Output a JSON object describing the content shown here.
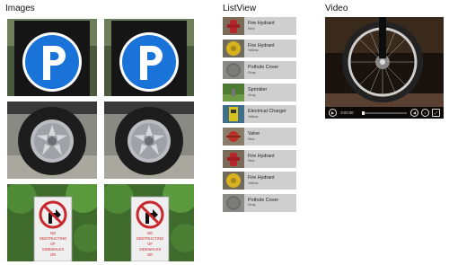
{
  "sections": {
    "images_title": "Images",
    "listview_title": "ListView",
    "video_title": "Video"
  },
  "images": [
    {
      "subject": "parking-sign"
    },
    {
      "subject": "parking-sign"
    },
    {
      "subject": "tire"
    },
    {
      "subject": "tire"
    },
    {
      "subject": "no-right-turn-sign"
    },
    {
      "subject": "no-right-turn-sign"
    }
  ],
  "sign_text": [
    "NO",
    "OBSTRUCTING",
    "OF",
    "SIDEWALKS",
    "OR"
  ],
  "list_items": [
    {
      "name": "Fire Hydrant",
      "color": "Red"
    },
    {
      "name": "Fire Hydrant",
      "color": "Yellow"
    },
    {
      "name": "Pothole Cover",
      "color": "Gray"
    },
    {
      "name": "Sprinkler",
      "color": "Gray"
    },
    {
      "name": "Electrical Charger",
      "color": "Yellow"
    },
    {
      "name": "Valve",
      "color": "Red"
    },
    {
      "name": "Fire Hydrant",
      "color": "Red"
    },
    {
      "name": "Fire Hydrant",
      "color": "Yellow"
    },
    {
      "name": "Pothole Cover",
      "color": "Gray"
    }
  ],
  "video": {
    "time": "0:00:00"
  },
  "colors": {
    "list_item_bg": "#cfcfcf",
    "parking_blue": "#1a73d9",
    "sign_red": "#c8282e"
  }
}
